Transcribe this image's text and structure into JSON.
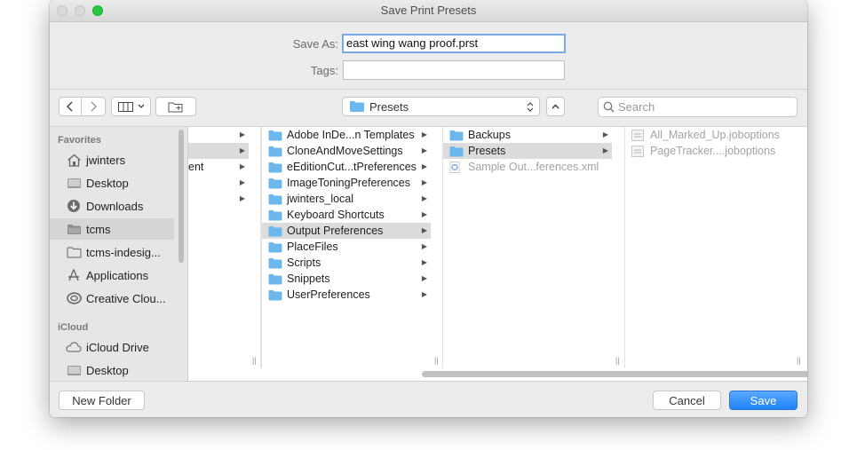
{
  "window": {
    "title": "Save Print Presets"
  },
  "form": {
    "save_as_label": "Save As:",
    "save_as_value": "east wing wang proof.prst",
    "tags_label": "Tags:",
    "tags_value": ""
  },
  "toolbar": {
    "location": "Presets",
    "search_placeholder": "Search"
  },
  "sidebar": {
    "favorites_label": "Favorites",
    "favorites": [
      {
        "label": "jwinters",
        "icon": "home-icon"
      },
      {
        "label": "Desktop",
        "icon": "desktop-icon"
      },
      {
        "label": "Downloads",
        "icon": "downloads-icon"
      },
      {
        "label": "tcms",
        "icon": "folder-icon"
      },
      {
        "label": "tcms-indesig...",
        "icon": "folder-icon"
      },
      {
        "label": "Applications",
        "icon": "applications-icon"
      },
      {
        "label": "Creative Clou...",
        "icon": "creative-cloud-icon"
      }
    ],
    "icloud_label": "iCloud",
    "icloud": [
      {
        "label": "iCloud Drive",
        "icon": "cloud-icon"
      },
      {
        "label": "Desktop",
        "icon": "desktop-icon"
      }
    ]
  },
  "columns": {
    "col0": [
      "",
      "",
      "ent",
      "",
      ""
    ],
    "col1": [
      "Adobe InDe...n Templates",
      "CloneAndMoveSettings",
      "eEditionCut...tPreferences",
      "ImageToningPreferences",
      "jwinters_local",
      "Keyboard Shortcuts",
      "Output Preferences",
      "PlaceFiles",
      "Scripts",
      "Snippets",
      "UserPreferences"
    ],
    "col2": [
      "Backups",
      "Presets",
      "Sample Out...ferences.xml"
    ],
    "col3": [
      "All_Marked_Up.joboptions",
      "PageTracker....joboptions"
    ]
  },
  "footer": {
    "new_folder": "New Folder",
    "cancel": "Cancel",
    "save": "Save"
  },
  "colors": {
    "accent": "#1f82f7",
    "folder": "#6cb8ee",
    "close_green": "#27c93f"
  }
}
